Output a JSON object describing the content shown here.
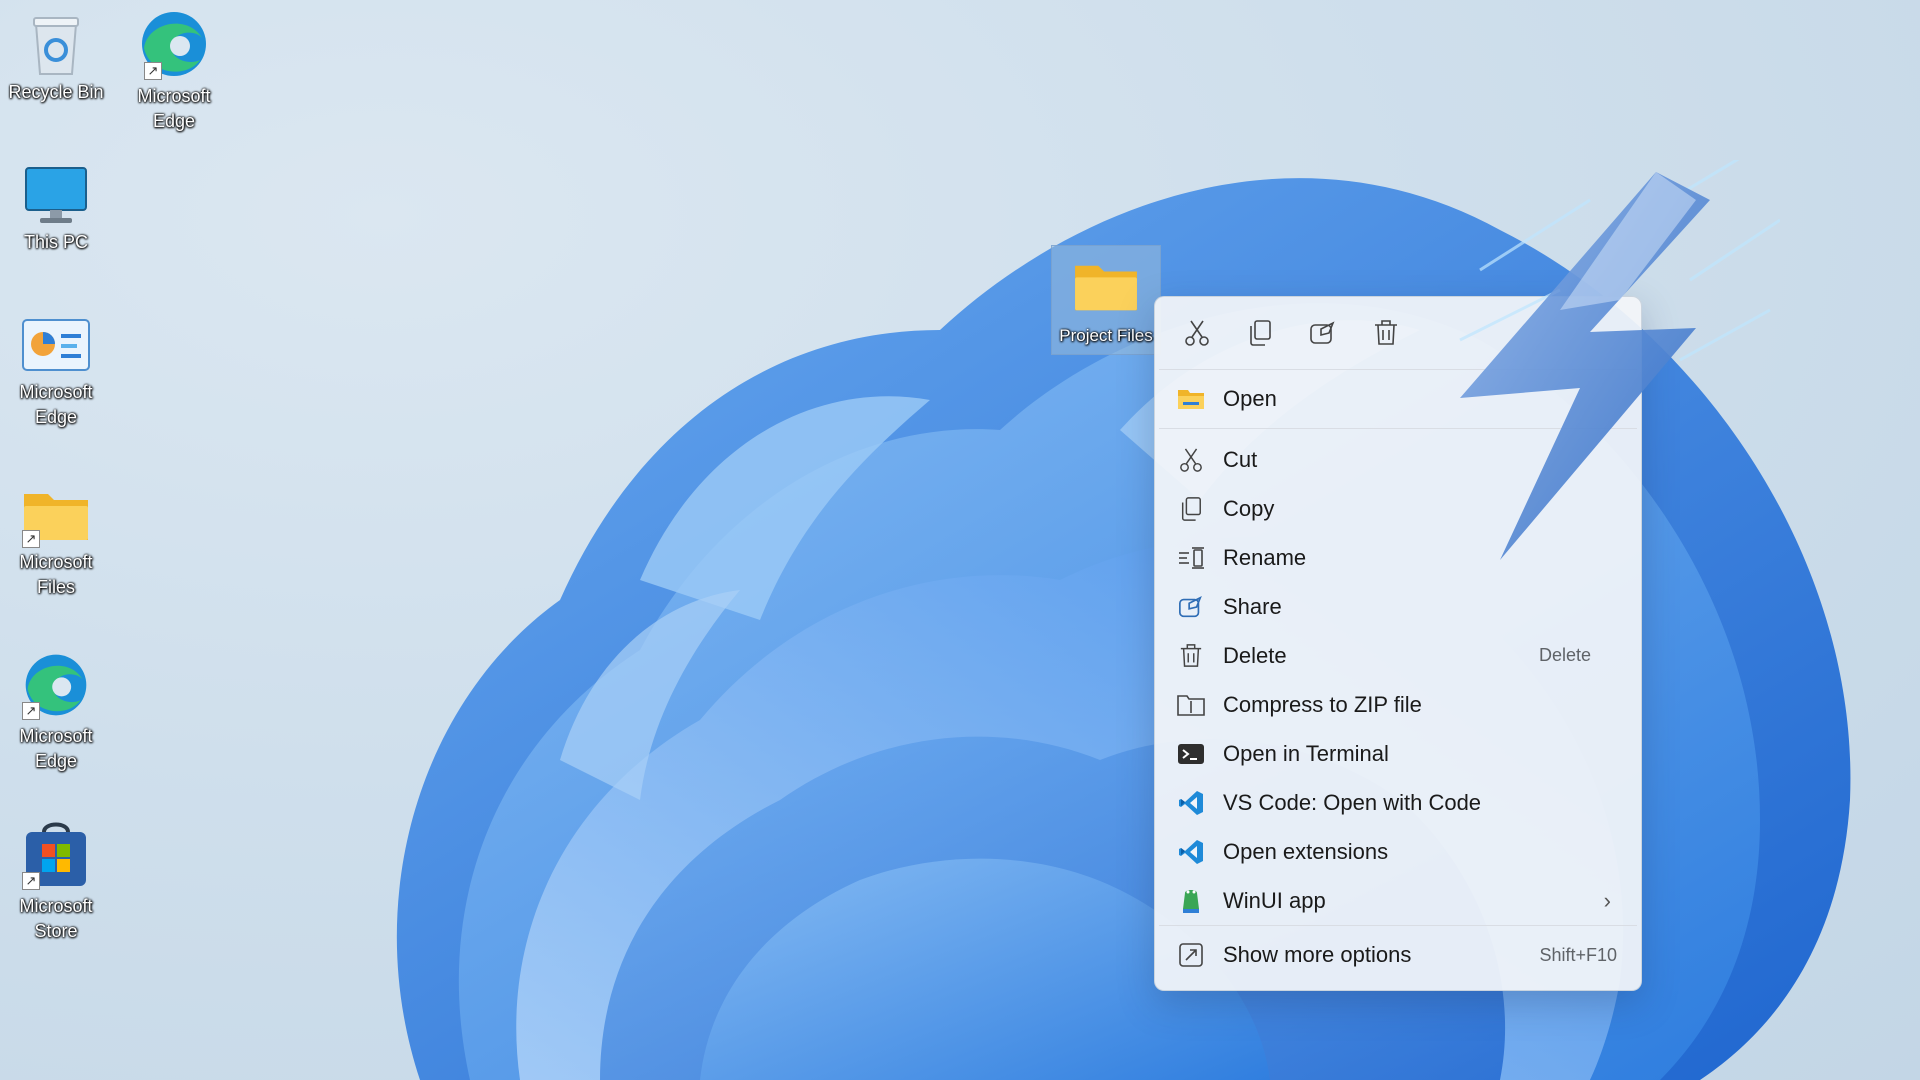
{
  "desktop": {
    "icons": [
      {
        "name": "recycle-bin",
        "label": "Recycle Bin"
      },
      {
        "name": "microsoft-edge-top",
        "label": "Microsoft Edge"
      },
      {
        "name": "this-pc",
        "label": "This PC"
      },
      {
        "name": "microsoft-edge-app",
        "label": "Microsoft Edge"
      },
      {
        "name": "microsoft-files",
        "label": "Microsoft Files"
      },
      {
        "name": "microsoft-edge-2",
        "label": "Microsoft Edge"
      },
      {
        "name": "microsoft-store",
        "label": "Microsoft Store"
      }
    ],
    "selected_folder": {
      "label": "Project Files"
    }
  },
  "context_menu": {
    "quick_actions": [
      {
        "name": "cut-icon"
      },
      {
        "name": "copy-icon"
      },
      {
        "name": "share-icon"
      },
      {
        "name": "delete-icon"
      }
    ],
    "items": [
      {
        "label": "Open",
        "shortcut": "",
        "icon": "folder-open-icon"
      },
      {
        "label": "Cut",
        "shortcut": "",
        "icon": "cut-icon"
      },
      {
        "label": "Copy",
        "shortcut": "",
        "icon": "copy-icon"
      },
      {
        "label": "Rename",
        "shortcut": "",
        "icon": "rename-icon"
      },
      {
        "label": "Share",
        "shortcut": "",
        "icon": "share-icon"
      },
      {
        "label": "Delete",
        "shortcut": "Delete",
        "icon": "delete-icon"
      },
      {
        "label": "Compress to ZIP file",
        "shortcut": "",
        "icon": "zip-icon"
      },
      {
        "label": "Open in Terminal",
        "shortcut": "",
        "icon": "terminal-icon"
      },
      {
        "label": "VS Code: Open with Code",
        "shortcut": "",
        "icon": "vscode-icon"
      },
      {
        "label": "Open extensions",
        "shortcut": "",
        "icon": "vscode-icon"
      },
      {
        "label": "WinUI app",
        "shortcut": "",
        "icon": "winui-app-icon",
        "submenu": true
      },
      {
        "label": "Show more options",
        "shortcut": "Shift+F10",
        "icon": "more-options-icon"
      }
    ]
  },
  "colors": {
    "accent": "#0067c0",
    "wallpaper_bloom": "#3f8fe8",
    "menu_bg": "#f3f5f9",
    "folder_yellow": "#f8c83c"
  }
}
